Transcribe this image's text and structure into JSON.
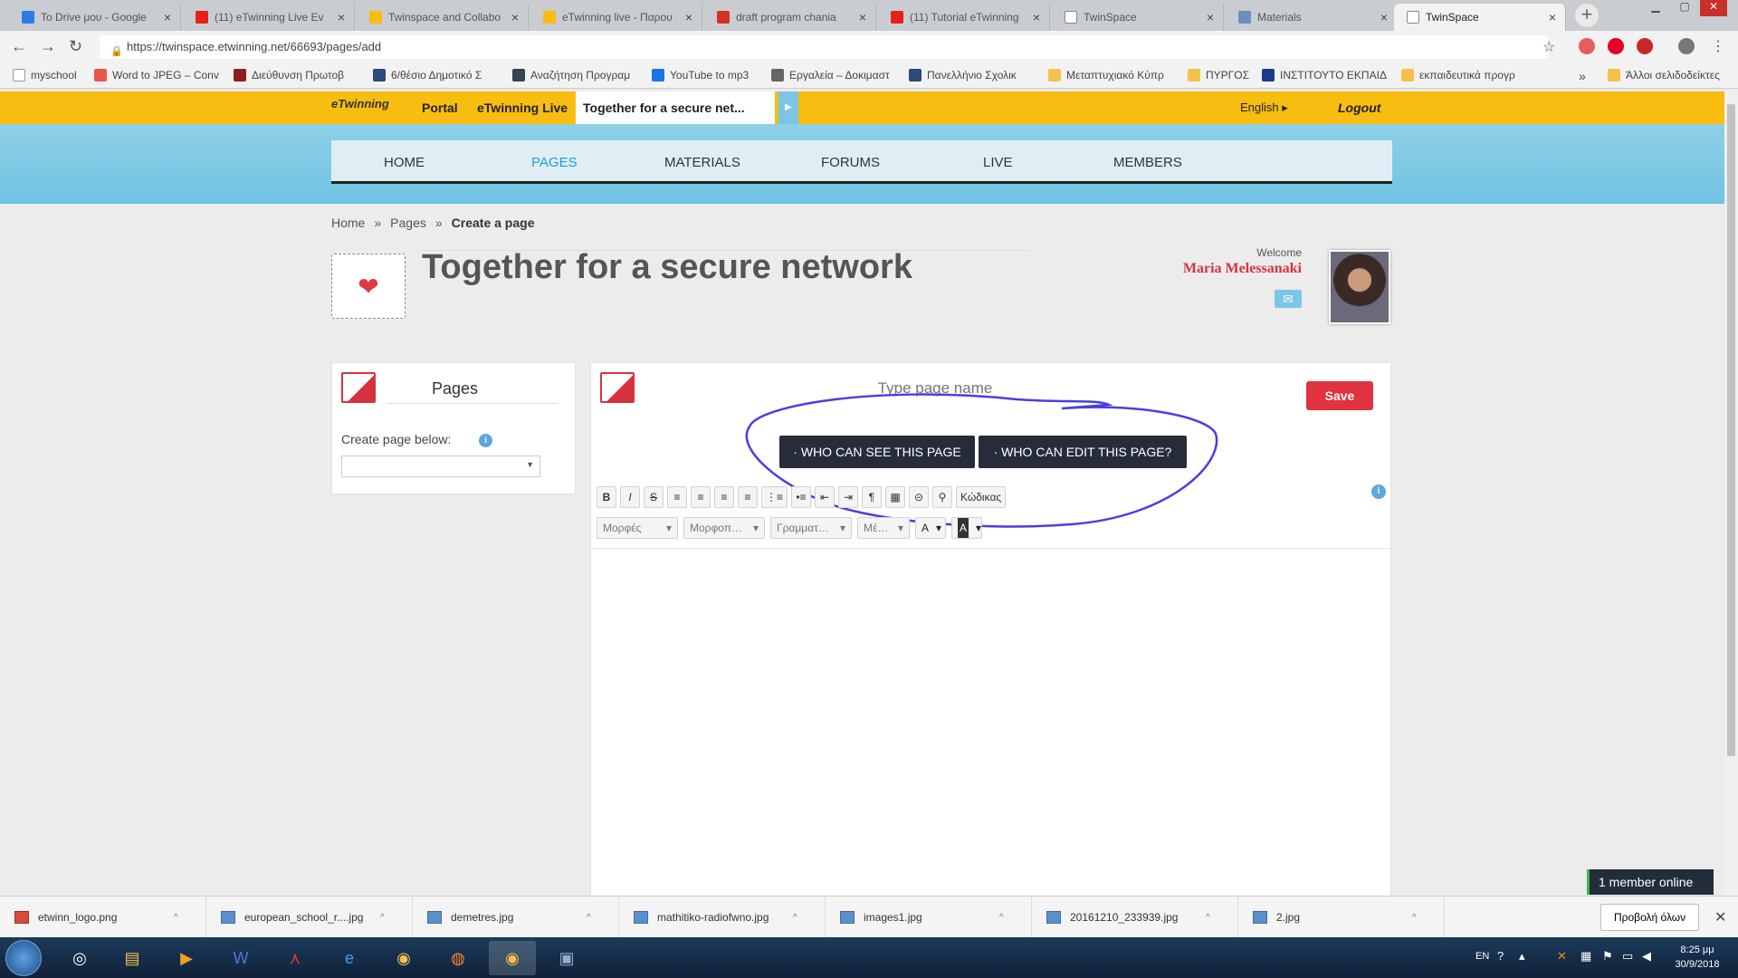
{
  "browser": {
    "tabs": [
      {
        "label": "To Drive μου - Google",
        "color": "#2a7de1"
      },
      {
        "label": "(11) eTwinning Live Ev",
        "color": "#e62117"
      },
      {
        "label": "Twinspace and Collabo",
        "color": "#f8bd11"
      },
      {
        "label": "eTwinning live - Παρου",
        "color": "#f8bd11"
      },
      {
        "label": "draft program chania",
        "color": "#d93025"
      },
      {
        "label": "(11) Tutorial eTwinning",
        "color": "#e62117"
      },
      {
        "label": "TwinSpace",
        "color": "#888888"
      },
      {
        "label": "Materials",
        "color": "#6a8fc0"
      },
      {
        "label": "TwinSpace",
        "color": "#888888"
      }
    ],
    "url": "https://twinspace.etwinning.net/66693/pages/add",
    "bookmarks": [
      "myschool",
      "Word to JPEG – Conv",
      "Διεύθυνση Πρωτοβ",
      "6/θέσιο Δημοτικό Σ",
      "Αναζήτηση Προγραμ",
      "YouTube to mp3",
      "Εργαλεία – Δοκιμαστ",
      "Πανελλήνιο Σχολικ",
      "Μεταπτυχιακό Κύπρ",
      "ΠΥΡΓΟΣ",
      "ΙΝΣΤΙΤΟΥΤΟ ΕΚΠΑΙΔ",
      "εκπαιδευτικά προγρ",
      "Άλλοι σελιδοδείκτες"
    ]
  },
  "site": {
    "logo": "eTwinning",
    "portal": "Portal",
    "live": "eTwinning Live",
    "crumb": "Together for a secure net...",
    "language": "English",
    "logout": "Logout"
  },
  "menu": [
    "HOME",
    "PAGES",
    "MATERIALS",
    "FORUMS",
    "LIVE",
    "MEMBERS"
  ],
  "breadcrumb": {
    "home": "Home",
    "pages": "Pages",
    "current": "Create a page",
    "sep": "»"
  },
  "header": {
    "title": "Together for a secure network",
    "welcome": "Welcome",
    "user": "Maria Melessanaki"
  },
  "pages_panel": {
    "title": "Pages",
    "create_below": "Create page below:"
  },
  "editor": {
    "name_placeholder": "Type page name",
    "save": "Save",
    "see": "· WHO CAN SEE THIS PAGE",
    "edit": "· WHO CAN EDIT THIS PAGE?",
    "tools": [
      "B",
      "I",
      "S",
      "≡",
      "≡",
      "≡",
      "≡",
      "⋮≡",
      "•≡",
      "⇤",
      "⇥",
      "¶",
      "▦",
      "⊝",
      "⚲",
      "Κώδικας"
    ],
    "dropdowns": [
      "Μορφές",
      "Μορφοπ…",
      "Γραμματ…",
      "Μέ…",
      "A",
      "A"
    ]
  },
  "member_online": "1 member online",
  "downloads": [
    "etwinn_logo.png",
    "european_school_r....jpg",
    "demetres.jpg",
    "mathitiko-radiofwno.jpg",
    "images1.jpg",
    "20161210_233939.jpg",
    "2.jpg"
  ],
  "show_all": "Προβολή όλων",
  "clock": {
    "time": "8:25 μμ",
    "date": "30/9/2018"
  },
  "tray_lang": "EN"
}
